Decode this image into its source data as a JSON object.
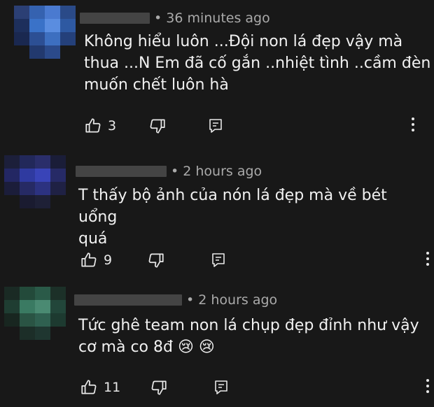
{
  "comments": [
    {
      "time": "• 36 minutes ago",
      "text_lines": [
        "Không hiểu luôn ...Đội non lá đẹp vậy mà",
        "thua ...N Em đã cố gắn ..nhiệt tình ..cầm đèn",
        "muốn chết luôn hà"
      ],
      "likes": "3",
      "avatar_colors": [
        "#2b3f74",
        "#3562b0",
        "#4a7ad0",
        "#2a4a88",
        "#1d2f5c",
        "#3a72c8",
        "#5a8de0",
        "#2e59a2",
        "#1a2850",
        "#2c4f94",
        "#3d6fc0",
        "#24407a",
        "#181818",
        "#22396e",
        "#2b4a8a",
        "#181818"
      ]
    },
    {
      "time": "• 2 hours ago",
      "text_lines": [
        "T thấy bộ ảnh của nón lá đẹp mà về bét uổng",
        "quá"
      ],
      "likes": "9",
      "avatar_colors": [
        "#1c1f3a",
        "#22285a",
        "#2a2e6a",
        "#1a1d38",
        "#232763",
        "#2f3aa0",
        "#3944b8",
        "#262a66",
        "#1b1d3a",
        "#262a64",
        "#2c3280",
        "#1f2144",
        "#181818",
        "#1a1b30",
        "#1e2036",
        "#181818"
      ]
    },
    {
      "time": "• 2 hours ago",
      "text_lines": [
        "Tức ghê team non lá chụp đẹp đỉnh như vậy",
        "cơ mà co 8đ 😢 😢"
      ],
      "likes": "11",
      "avatar_colors": [
        "#1a2a24",
        "#234a3a",
        "#2a5a48",
        "#1c3028",
        "#1f3d32",
        "#3a7a62",
        "#4a8a72",
        "#22463a",
        "#182620",
        "#2a5444",
        "#2f6050",
        "#1d3a30",
        "#181818",
        "#1c2e28",
        "#1f3630",
        "#181818"
      ]
    }
  ],
  "icons": {
    "like": "thumbs-up-icon",
    "dislike": "thumbs-down-icon",
    "reply": "reply-icon",
    "more": "more-vert-icon"
  }
}
